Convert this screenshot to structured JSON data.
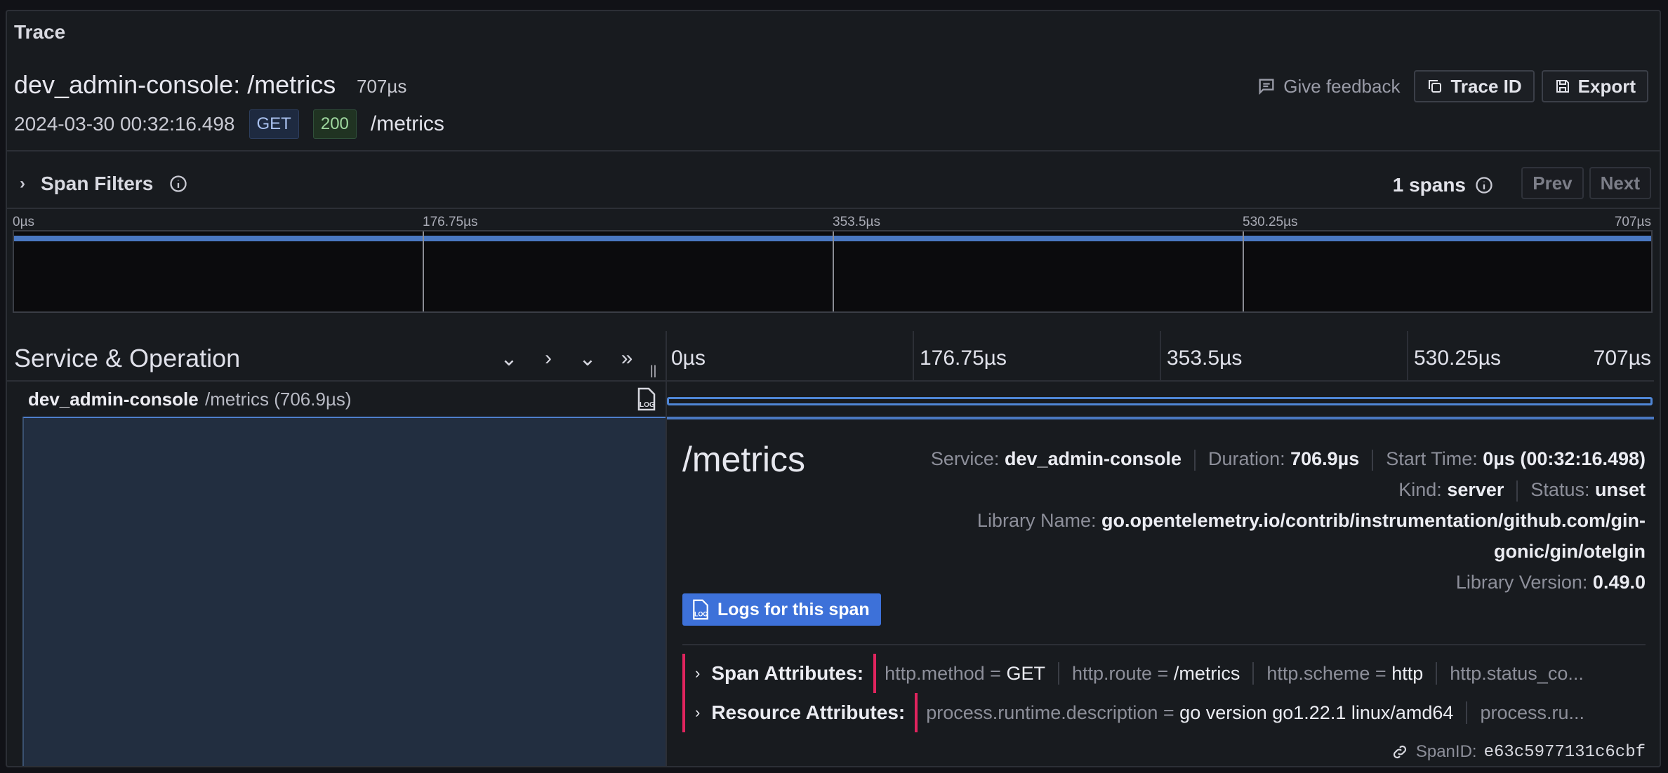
{
  "header": {
    "label": "Trace",
    "title": "dev_admin-console: /metrics",
    "duration": "707µs",
    "timestamp": "2024-03-30 00:32:16.498",
    "method": "GET",
    "status": "200",
    "route": "/metrics"
  },
  "actions": {
    "feedback": "Give feedback",
    "trace_id": "Trace ID",
    "export": "Export"
  },
  "filters": {
    "label": "Span Filters",
    "count": "1 spans",
    "prev": "Prev",
    "next": "Next"
  },
  "minimap": {
    "ticks": [
      "0µs",
      "176.75µs",
      "353.5µs",
      "530.25µs",
      "707µs"
    ]
  },
  "timeline": {
    "title": "Service & Operation",
    "ticks": [
      "0µs",
      "176.75µs",
      "353.5µs",
      "530.25µs",
      "707µs"
    ]
  },
  "span": {
    "service": "dev_admin-console",
    "operation": "/metrics (706.9µs)"
  },
  "details": {
    "op_title": "/metrics",
    "service_label": "Service:",
    "service": "dev_admin-console",
    "duration_label": "Duration:",
    "duration": "706.9µs",
    "start_label": "Start Time:",
    "start": "0µs (00:32:16.498)",
    "kind_label": "Kind:",
    "kind": "server",
    "status_label": "Status:",
    "status": "unset",
    "library_name_label": "Library Name:",
    "library_name_1": "go.opentelemetry.io/contrib/instrumentation/github.com/gin-",
    "library_name_2": "gonic/gin/otelgin",
    "library_version_label": "Library Version:",
    "library_version": "0.49.0",
    "logs_button": "Logs for this span",
    "span_attributes_label": "Span Attributes:",
    "span_attributes": [
      {
        "key": "http.method",
        "value": "GET"
      },
      {
        "key": "http.route",
        "value": "/metrics"
      },
      {
        "key": "http.scheme",
        "value": "http"
      },
      {
        "key": "http.status_co...",
        "value": ""
      }
    ],
    "resource_attributes_label": "Resource Attributes:",
    "resource_attributes": [
      {
        "key": "process.runtime.description",
        "value": "go version go1.22.1 linux/amd64"
      },
      {
        "key": "process.ru...",
        "value": ""
      }
    ],
    "spanid_label": "SpanID:",
    "spanid": "e63c5977131c6cbf"
  },
  "colors": {
    "accent": "#4a78c2",
    "highlight": "#e0245e",
    "button": "#3d71d9"
  }
}
